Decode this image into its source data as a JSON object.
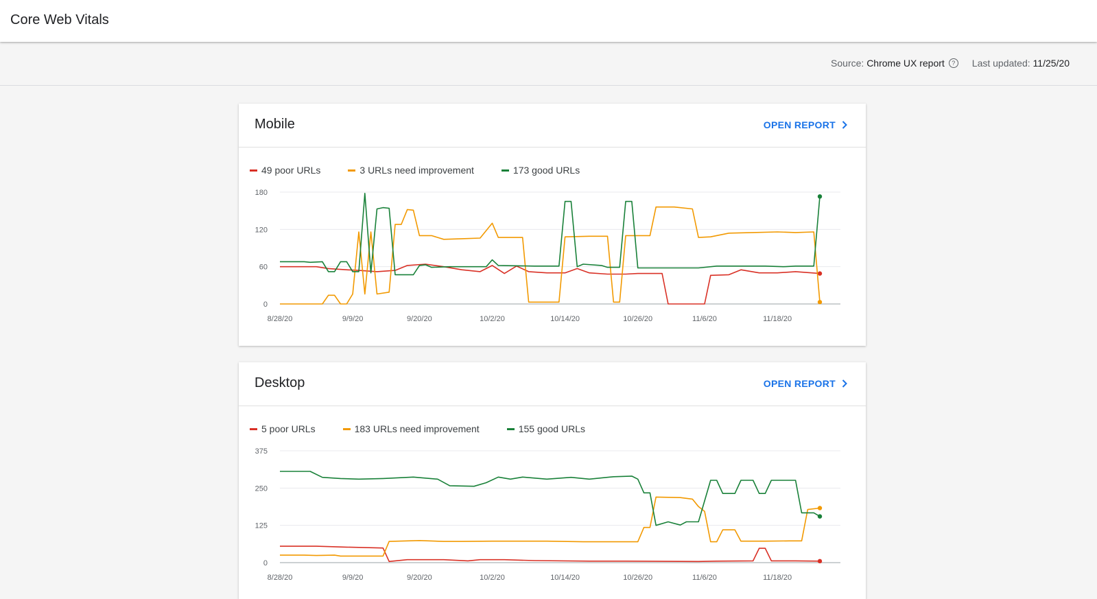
{
  "page": {
    "title": "Core Web Vitals"
  },
  "meta": {
    "source_label": "Source:",
    "source_value": "Chrome UX report",
    "updated_label": "Last updated:",
    "updated_value": "11/25/20"
  },
  "colors": {
    "poor": "#d93025",
    "needs": "#f29900",
    "good": "#188038",
    "accent": "#1a73e8"
  },
  "mobile": {
    "title": "Mobile",
    "open_label": "OPEN REPORT",
    "legend": {
      "poor": "49 poor URLs",
      "needs": "3 URLs need improvement",
      "good": "173 good URLs"
    }
  },
  "desktop": {
    "title": "Desktop",
    "open_label": "OPEN REPORT",
    "legend": {
      "poor": "5 poor URLs",
      "needs": "183 URLs need improvement",
      "good": "155 good URLs"
    }
  },
  "chart_data": [
    {
      "type": "line",
      "panel": "mobile",
      "x_ticks": [
        "8/28/20",
        "9/9/20",
        "9/20/20",
        "10/2/20",
        "10/14/20",
        "10/26/20",
        "11/6/20",
        "11/18/20"
      ],
      "y_ticks": [
        0,
        60,
        120,
        180
      ],
      "ylim": [
        0,
        180
      ],
      "x_domain": [
        "2020-08-28",
        "2020-11-25"
      ],
      "grid": true,
      "legend_position": "top-left",
      "series": [
        {
          "name": "49 poor URLs",
          "color": "#d93025",
          "points": [
            [
              "2020-08-28",
              60
            ],
            [
              "2020-09-03",
              60
            ],
            [
              "2020-09-05",
              57
            ],
            [
              "2020-09-08",
              55
            ],
            [
              "2020-09-10",
              54
            ],
            [
              "2020-09-13",
              52
            ],
            [
              "2020-09-16",
              54
            ],
            [
              "2020-09-18",
              62
            ],
            [
              "2020-09-21",
              64
            ],
            [
              "2020-09-24",
              60
            ],
            [
              "2020-09-27",
              55
            ],
            [
              "2020-09-30",
              52
            ],
            [
              "2020-10-02",
              62
            ],
            [
              "2020-10-04",
              49
            ],
            [
              "2020-10-06",
              61
            ],
            [
              "2020-10-08",
              52
            ],
            [
              "2020-10-11",
              50
            ],
            [
              "2020-10-14",
              50
            ],
            [
              "2020-10-16",
              57
            ],
            [
              "2020-10-18",
              50
            ],
            [
              "2020-10-21",
              48
            ],
            [
              "2020-10-24",
              48
            ],
            [
              "2020-10-26",
              49
            ],
            [
              "2020-10-30",
              49
            ],
            [
              "2020-10-31",
              0
            ],
            [
              "2020-11-06",
              0
            ],
            [
              "2020-11-07",
              46
            ],
            [
              "2020-11-10",
              47
            ],
            [
              "2020-11-12",
              55
            ],
            [
              "2020-11-15",
              50
            ],
            [
              "2020-11-18",
              50
            ],
            [
              "2020-11-21",
              52
            ],
            [
              "2020-11-25",
              49
            ]
          ]
        },
        {
          "name": "3 URLs need improvement",
          "color": "#f29900",
          "points": [
            [
              "2020-08-28",
              0
            ],
            [
              "2020-09-04",
              0
            ],
            [
              "2020-09-05",
              14
            ],
            [
              "2020-09-06",
              14
            ],
            [
              "2020-09-07",
              0
            ],
            [
              "2020-09-08",
              0
            ],
            [
              "2020-09-09",
              16
            ],
            [
              "2020-09-10",
              116
            ],
            [
              "2020-09-11",
              16
            ],
            [
              "2020-09-12",
              116
            ],
            [
              "2020-09-13",
              16
            ],
            [
              "2020-09-15",
              19
            ],
            [
              "2020-09-16",
              128
            ],
            [
              "2020-09-17",
              128
            ],
            [
              "2020-09-18",
              152
            ],
            [
              "2020-09-19",
              151
            ],
            [
              "2020-09-20",
              110
            ],
            [
              "2020-09-22",
              110
            ],
            [
              "2020-09-24",
              104
            ],
            [
              "2020-09-27",
              105
            ],
            [
              "2020-09-30",
              106
            ],
            [
              "2020-10-02",
              130
            ],
            [
              "2020-10-03",
              107
            ],
            [
              "2020-10-07",
              107
            ],
            [
              "2020-10-08",
              3
            ],
            [
              "2020-10-13",
              3
            ],
            [
              "2020-10-14",
              108
            ],
            [
              "2020-10-18",
              109
            ],
            [
              "2020-10-21",
              109
            ],
            [
              "2020-10-22",
              3
            ],
            [
              "2020-10-23",
              3
            ],
            [
              "2020-10-24",
              110
            ],
            [
              "2020-10-28",
              110
            ],
            [
              "2020-10-29",
              156
            ],
            [
              "2020-11-01",
              156
            ],
            [
              "2020-11-04",
              153
            ],
            [
              "2020-11-05",
              107
            ],
            [
              "2020-11-07",
              108
            ],
            [
              "2020-11-10",
              114
            ],
            [
              "2020-11-14",
              115
            ],
            [
              "2020-11-18",
              116
            ],
            [
              "2020-11-21",
              115
            ],
            [
              "2020-11-24",
              116
            ],
            [
              "2020-11-25",
              3
            ]
          ]
        },
        {
          "name": "173 good URLs",
          "color": "#188038",
          "points": [
            [
              "2020-08-28",
              68
            ],
            [
              "2020-09-01",
              68
            ],
            [
              "2020-09-02",
              67
            ],
            [
              "2020-09-04",
              68
            ],
            [
              "2020-09-05",
              52
            ],
            [
              "2020-09-06",
              52
            ],
            [
              "2020-09-07",
              68
            ],
            [
              "2020-09-08",
              68
            ],
            [
              "2020-09-09",
              52
            ],
            [
              "2020-09-10",
              52
            ],
            [
              "2020-09-11",
              178
            ],
            [
              "2020-09-12",
              50
            ],
            [
              "2020-09-13",
              153
            ],
            [
              "2020-09-14",
              155
            ],
            [
              "2020-09-15",
              154
            ],
            [
              "2020-09-16",
              47
            ],
            [
              "2020-09-19",
              47
            ],
            [
              "2020-09-20",
              62
            ],
            [
              "2020-09-21",
              63
            ],
            [
              "2020-09-22",
              59
            ],
            [
              "2020-09-25",
              60
            ],
            [
              "2020-09-28",
              60
            ],
            [
              "2020-10-01",
              60
            ],
            [
              "2020-10-02",
              71
            ],
            [
              "2020-10-03",
              62
            ],
            [
              "2020-10-09",
              61
            ],
            [
              "2020-10-13",
              61
            ],
            [
              "2020-10-14",
              165
            ],
            [
              "2020-10-15",
              165
            ],
            [
              "2020-10-16",
              60
            ],
            [
              "2020-10-17",
              64
            ],
            [
              "2020-10-20",
              62
            ],
            [
              "2020-10-21",
              59
            ],
            [
              "2020-10-23",
              59
            ],
            [
              "2020-10-24",
              165
            ],
            [
              "2020-10-25",
              165
            ],
            [
              "2020-10-26",
              58
            ],
            [
              "2020-11-05",
              58
            ],
            [
              "2020-11-08",
              61
            ],
            [
              "2020-11-16",
              61
            ],
            [
              "2020-11-19",
              60
            ],
            [
              "2020-11-21",
              61
            ],
            [
              "2020-11-24",
              61
            ],
            [
              "2020-11-25",
              173
            ]
          ]
        }
      ]
    },
    {
      "type": "line",
      "panel": "desktop",
      "x_ticks": [
        "8/28/20",
        "9/9/20",
        "9/20/20",
        "10/2/20",
        "10/14/20",
        "10/26/20",
        "11/6/20",
        "11/18/20"
      ],
      "y_ticks": [
        0,
        125,
        250,
        375
      ],
      "ylim": [
        0,
        375
      ],
      "x_domain": [
        "2020-08-28",
        "2020-11-25"
      ],
      "grid": true,
      "legend_position": "top-left",
      "series": [
        {
          "name": "5 poor URLs",
          "color": "#d93025",
          "points": [
            [
              "2020-08-28",
              55
            ],
            [
              "2020-09-03",
              55
            ],
            [
              "2020-09-08",
              52
            ],
            [
              "2020-09-14",
              49
            ],
            [
              "2020-09-15",
              4
            ],
            [
              "2020-09-18",
              10
            ],
            [
              "2020-09-24",
              10
            ],
            [
              "2020-09-28",
              6
            ],
            [
              "2020-09-30",
              10
            ],
            [
              "2020-10-04",
              10
            ],
            [
              "2020-10-09",
              7
            ],
            [
              "2020-10-18",
              5
            ],
            [
              "2020-10-24",
              5
            ],
            [
              "2020-11-05",
              4
            ],
            [
              "2020-11-08",
              5
            ],
            [
              "2020-11-14",
              6
            ],
            [
              "2020-11-15",
              48
            ],
            [
              "2020-11-16",
              48
            ],
            [
              "2020-11-17",
              6
            ],
            [
              "2020-11-21",
              6
            ],
            [
              "2020-11-25",
              5
            ]
          ]
        },
        {
          "name": "183 URLs need improvement",
          "color": "#f29900",
          "points": [
            [
              "2020-08-28",
              25
            ],
            [
              "2020-09-01",
              25
            ],
            [
              "2020-09-03",
              24
            ],
            [
              "2020-09-06",
              25
            ],
            [
              "2020-09-07",
              22
            ],
            [
              "2020-09-14",
              22
            ],
            [
              "2020-09-15",
              71
            ],
            [
              "2020-09-20",
              74
            ],
            [
              "2020-09-24",
              71
            ],
            [
              "2020-09-27",
              71
            ],
            [
              "2020-10-02",
              72
            ],
            [
              "2020-10-11",
              72
            ],
            [
              "2020-10-17",
              70
            ],
            [
              "2020-10-26",
              70
            ],
            [
              "2020-10-27",
              118
            ],
            [
              "2020-10-28",
              118
            ],
            [
              "2020-10-29",
              220
            ],
            [
              "2020-11-02",
              218
            ],
            [
              "2020-11-04",
              213
            ],
            [
              "2020-11-05",
              188
            ],
            [
              "2020-11-06",
              172
            ],
            [
              "2020-11-07",
              70
            ],
            [
              "2020-11-08",
              70
            ],
            [
              "2020-11-09",
              110
            ],
            [
              "2020-11-11",
              110
            ],
            [
              "2020-11-12",
              72
            ],
            [
              "2020-11-16",
              72
            ],
            [
              "2020-11-20",
              73
            ],
            [
              "2020-11-22",
              73
            ],
            [
              "2020-11-23",
              178
            ],
            [
              "2020-11-25",
              183
            ]
          ]
        },
        {
          "name": "155 good URLs",
          "color": "#188038",
          "points": [
            [
              "2020-08-28",
              306
            ],
            [
              "2020-09-02",
              306
            ],
            [
              "2020-09-04",
              286
            ],
            [
              "2020-09-07",
              282
            ],
            [
              "2020-09-10",
              280
            ],
            [
              "2020-09-14",
              282
            ],
            [
              "2020-09-19",
              287
            ],
            [
              "2020-09-23",
              280
            ],
            [
              "2020-09-25",
              258
            ],
            [
              "2020-09-29",
              256
            ],
            [
              "2020-10-01",
              268
            ],
            [
              "2020-10-03",
              287
            ],
            [
              "2020-10-05",
              280
            ],
            [
              "2020-10-07",
              287
            ],
            [
              "2020-10-11",
              280
            ],
            [
              "2020-10-15",
              286
            ],
            [
              "2020-10-18",
              280
            ],
            [
              "2020-10-22",
              288
            ],
            [
              "2020-10-25",
              290
            ],
            [
              "2020-10-26",
              280
            ],
            [
              "2020-10-27",
              234
            ],
            [
              "2020-10-28",
              234
            ],
            [
              "2020-10-29",
              125
            ],
            [
              "2020-10-31",
              137
            ],
            [
              "2020-11-02",
              126
            ],
            [
              "2020-11-03",
              137
            ],
            [
              "2020-11-05",
              137
            ],
            [
              "2020-11-07",
              276
            ],
            [
              "2020-11-08",
              276
            ],
            [
              "2020-11-09",
              232
            ],
            [
              "2020-11-11",
              232
            ],
            [
              "2020-11-12",
              276
            ],
            [
              "2020-11-14",
              276
            ],
            [
              "2020-11-15",
              232
            ],
            [
              "2020-11-16",
              232
            ],
            [
              "2020-11-17",
              276
            ],
            [
              "2020-11-21",
              276
            ],
            [
              "2020-11-22",
              167
            ],
            [
              "2020-11-24",
              167
            ],
            [
              "2020-11-25",
              155
            ]
          ]
        }
      ]
    }
  ]
}
